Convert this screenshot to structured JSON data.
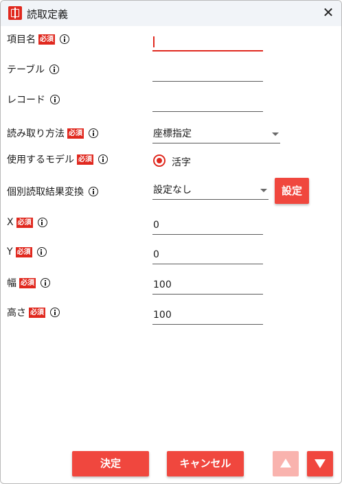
{
  "window": {
    "title": "読取定義",
    "close_icon": "close-icon",
    "app_icon": "app-logo-icon"
  },
  "required_badge": "必須",
  "colors": {
    "accent": "#e0281e",
    "button": "#f0473e",
    "button_disabled": "#f9b3ae"
  },
  "fields": {
    "item_name": {
      "label": "項目名",
      "value": "",
      "required": true
    },
    "table": {
      "label": "テーブル",
      "value": ""
    },
    "record": {
      "label": "レコード",
      "value": ""
    },
    "read_method": {
      "label": "読み取り方法",
      "value": "座標指定",
      "required": true
    },
    "model": {
      "label": "使用するモデル",
      "option": "活字",
      "required": true
    },
    "conversion": {
      "label": "個別読取結果変換",
      "value": "設定なし",
      "button": "設定"
    },
    "x": {
      "label": "X",
      "value": "0",
      "required": true
    },
    "y": {
      "label": "Y",
      "value": "0",
      "required": true
    },
    "width": {
      "label": "幅",
      "value": "100",
      "required": true
    },
    "height": {
      "label": "高さ",
      "value": "100",
      "required": true
    }
  },
  "footer": {
    "ok": "決定",
    "cancel": "キャンセル",
    "up_icon": "arrow-up-icon",
    "down_icon": "arrow-down-icon"
  }
}
